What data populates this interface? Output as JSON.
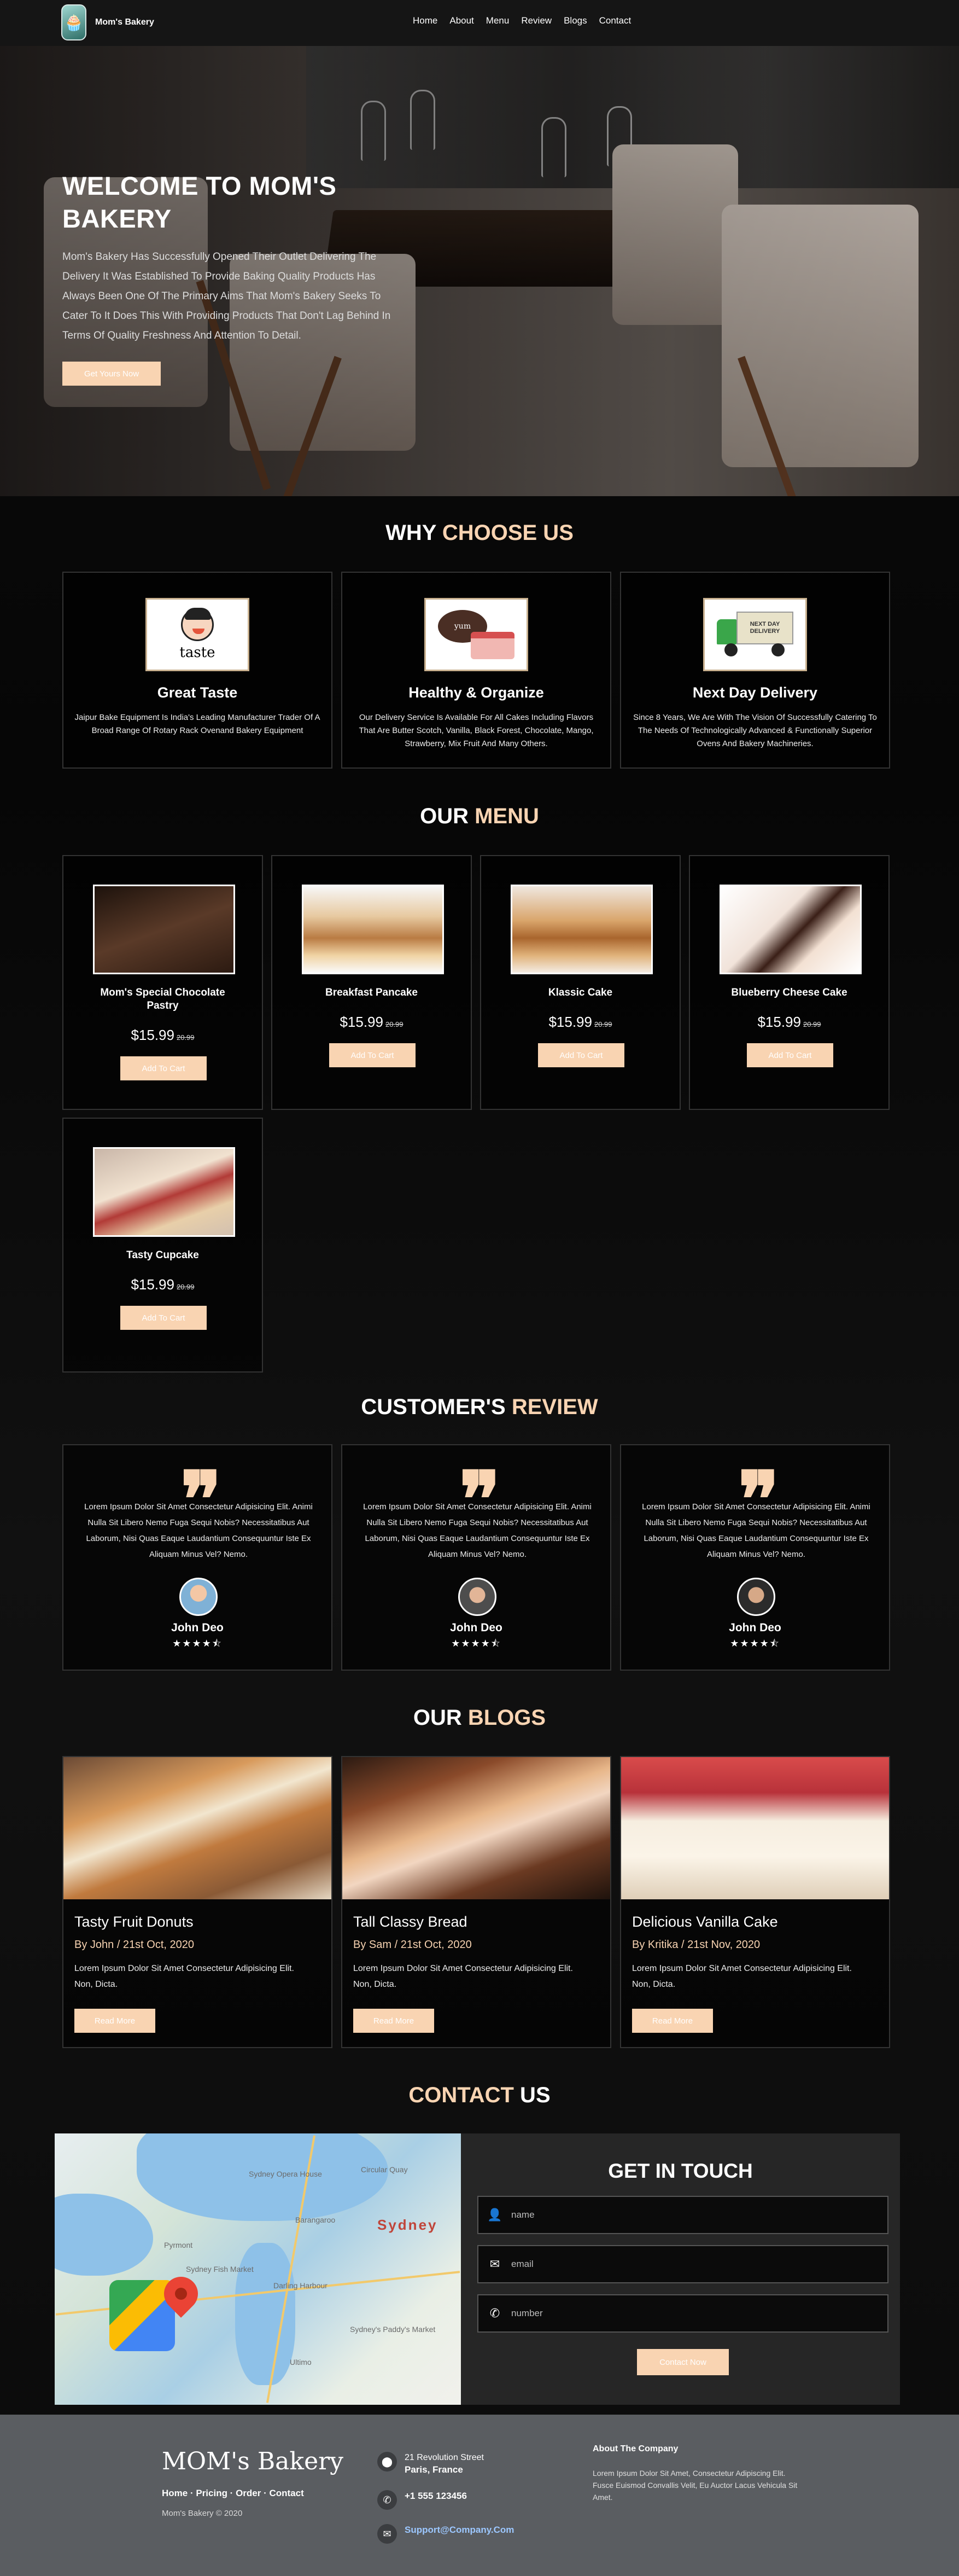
{
  "brand": {
    "name": "Mom's Bakery"
  },
  "nav": [
    "Home",
    "About",
    "Menu",
    "Review",
    "Blogs",
    "Contact"
  ],
  "hero": {
    "title": "WELCOME TO MOM'S BAKERY",
    "description": "Mom's Bakery Has Successfully Opened Their Outlet Delivering The Delivery It Was Established To Provide Baking Quality Products Has Always Been One Of The Primary Aims That Mom's Bakery Seeks To Cater To It Does This With Providing Products That Don't Lag Behind In Terms Of Quality Freshness And Attention To Detail.",
    "button": "Get Yours Now"
  },
  "why": {
    "title_white": "WHY ",
    "title_accent": "CHOOSE US",
    "items": [
      {
        "icon": "taste-icon",
        "img_text": "taste",
        "title": "Great Taste",
        "desc": "Jaipur Bake Equipment Is India's Leading Manufacturer Trader Of A Broad Range Of Rotary Rack Ovenand Bakery Equipment"
      },
      {
        "icon": "cake-icon",
        "img_text": "yum",
        "title": "Healthy & Organize",
        "desc": "Our Delivery Service Is Available For All Cakes Including Flavors That Are Butter Scotch, Vanilla, Black Forest, Chocolate, Mango, Strawberry, Mix Fruit And Many Others."
      },
      {
        "icon": "delivery-truck-icon",
        "img_text": "NEXT DAY DELIVERY",
        "title": "Next Day Delivery",
        "desc": "Since 8 Years, We Are With The Vision Of Successfully Catering To The Needs Of Technologically Advanced & Functionally Superior Ovens And Bakery Machineries."
      }
    ]
  },
  "menu": {
    "title_white": "OUR ",
    "title_accent": "MENU",
    "items": [
      {
        "name": "Mom's Special Chocolate Pastry",
        "price": "$15.99",
        "old": "20.99",
        "button": "Add To Cart"
      },
      {
        "name": "Breakfast Pancake",
        "price": "$15.99",
        "old": "20.99",
        "button": "Add To Cart"
      },
      {
        "name": "Klassic Cake",
        "price": "$15.99",
        "old": "20.99",
        "button": "Add To Cart"
      },
      {
        "name": "Blueberry Cheese Cake",
        "price": "$15.99",
        "old": "20.99",
        "button": "Add To Cart"
      },
      {
        "name": "Tasty Cupcake",
        "price": "$15.99",
        "old": "20.99",
        "button": "Add To Cart"
      }
    ]
  },
  "review": {
    "title_white": "CUSTOMER'S ",
    "title_accent": "REVIEW",
    "items": [
      {
        "text": "Lorem Ipsum Dolor Sit Amet Consectetur Adipisicing Elit. Animi Nulla Sit Libero Nemo Fuga Sequi Nobis? Necessitatibus Aut Laborum, Nisi Quas Eaque Laudantium Consequuntur Iste Ex Aliquam Minus Vel? Nemo.",
        "name": "John Deo",
        "stars": "★★★★⯪"
      },
      {
        "text": "Lorem Ipsum Dolor Sit Amet Consectetur Adipisicing Elit. Animi Nulla Sit Libero Nemo Fuga Sequi Nobis? Necessitatibus Aut Laborum, Nisi Quas Eaque Laudantium Consequuntur Iste Ex Aliquam Minus Vel? Nemo.",
        "name": "John Deo",
        "stars": "★★★★⯪"
      },
      {
        "text": "Lorem Ipsum Dolor Sit Amet Consectetur Adipisicing Elit. Animi Nulla Sit Libero Nemo Fuga Sequi Nobis? Necessitatibus Aut Laborum, Nisi Quas Eaque Laudantium Consequuntur Iste Ex Aliquam Minus Vel? Nemo.",
        "name": "John Deo",
        "stars": "★★★★⯪"
      }
    ]
  },
  "blogs": {
    "title_white": "OUR ",
    "title_accent": "BLOGS",
    "items": [
      {
        "title": "Tasty Fruit Donuts",
        "meta": "By John / 21st Oct, 2020",
        "desc": "Lorem Ipsum Dolor Sit Amet Consectetur Adipisicing Elit. Non, Dicta.",
        "button": "Read More"
      },
      {
        "title": "Tall Classy Bread",
        "meta": "By Sam / 21st Oct, 2020",
        "desc": "Lorem Ipsum Dolor Sit Amet Consectetur Adipisicing Elit. Non, Dicta.",
        "button": "Read More"
      },
      {
        "title": "Delicious Vanilla Cake",
        "meta": "By Kritika / 21st Nov, 2020",
        "desc": "Lorem Ipsum Dolor Sit Amet Consectetur Adipisicing Elit. Non, Dicta.",
        "button": "Read More"
      }
    ]
  },
  "contact": {
    "title_accent": "CONTACT",
    "title_white": " US",
    "map_labels": [
      "Sydney",
      "Pyrmont",
      "Sydney Fish Market",
      "Darling Harbour",
      "Ultimo",
      "Circular Quay",
      "Sydney Opera House",
      "Barangaroo",
      "Sydney's Paddy's Market"
    ],
    "form_title": "GET IN TOUCH",
    "name_placeholder": "name",
    "email_placeholder": "email",
    "number_placeholder": "number",
    "button": "Contact Now"
  },
  "footer": {
    "brand": "MOM's Bakery",
    "links": "Home · Pricing · Order · Contact",
    "copyright": "Mom's Bakery © 2020",
    "address_line1": "21 Revolution Street",
    "address_line2": "Paris, France",
    "phone": "+1 555 123456",
    "email": "Support@Company.Com",
    "about_title": "About The Company",
    "about_text": "Lorem Ipsum Dolor Sit Amet, Consectetur Adipiscing Elit. Fusce Euismod Convallis Velit, Eu Auctor Lacus Vehicula Sit Amet."
  },
  "colors": {
    "accent": "#f9d4b2",
    "background": "#000000",
    "nav": "#151515",
    "footer": "#5a5d61"
  }
}
